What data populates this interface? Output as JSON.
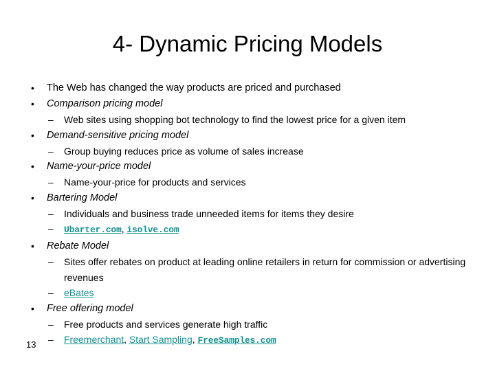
{
  "slide": {
    "title": "4- Dynamic Pricing Models",
    "page_number": "13",
    "link_color": "#11918f",
    "text_color": "#000000",
    "background_color": "#ffffff",
    "bullet_marker": "•",
    "dash_marker": "–",
    "lines": [
      {
        "level": 1,
        "italic": false,
        "text": "The Web has changed the way products are priced and purchased"
      },
      {
        "level": 1,
        "italic": true,
        "text": "Comparison pricing model"
      },
      {
        "level": 2,
        "text": "Web sites using shopping bot technology to find the lowest price for a given item"
      },
      {
        "level": 1,
        "italic": true,
        "text": "Demand-sensitive pricing model"
      },
      {
        "level": 2,
        "text": "Group buying reduces price as volume of sales increase"
      },
      {
        "level": 1,
        "italic": true,
        "text": "Name-your-price model"
      },
      {
        "level": 2,
        "text": "Name-your-price for products and services"
      },
      {
        "level": 1,
        "italic": true,
        "text": "Bartering Model"
      },
      {
        "level": 2,
        "text": "Individuals and business trade unneeded items for items they desire"
      },
      {
        "level": 2,
        "links": [
          {
            "label": "Ubarter.com",
            "style": "mono"
          },
          {
            "label": "isolve.com",
            "style": "mono"
          }
        ],
        "separator": ", "
      },
      {
        "level": 1,
        "italic": true,
        "text": "Rebate Model"
      },
      {
        "level": 2,
        "text": "Sites offer rebates on product at leading online retailers in return for commission or advertising revenues"
      },
      {
        "level": 2,
        "links": [
          {
            "label": "eBates",
            "style": "sans"
          }
        ],
        "separator": ", "
      },
      {
        "level": 1,
        "italic": true,
        "text": "Free offering model"
      },
      {
        "level": 2,
        "text": "Free products and services generate high traffic"
      },
      {
        "level": 2,
        "links": [
          {
            "label": "Freemerchant",
            "style": "sans"
          },
          {
            "label": "Start Sampling",
            "style": "sans"
          },
          {
            "label": "FreeSamples.com",
            "style": "mono"
          }
        ],
        "separator": ", "
      }
    ]
  }
}
